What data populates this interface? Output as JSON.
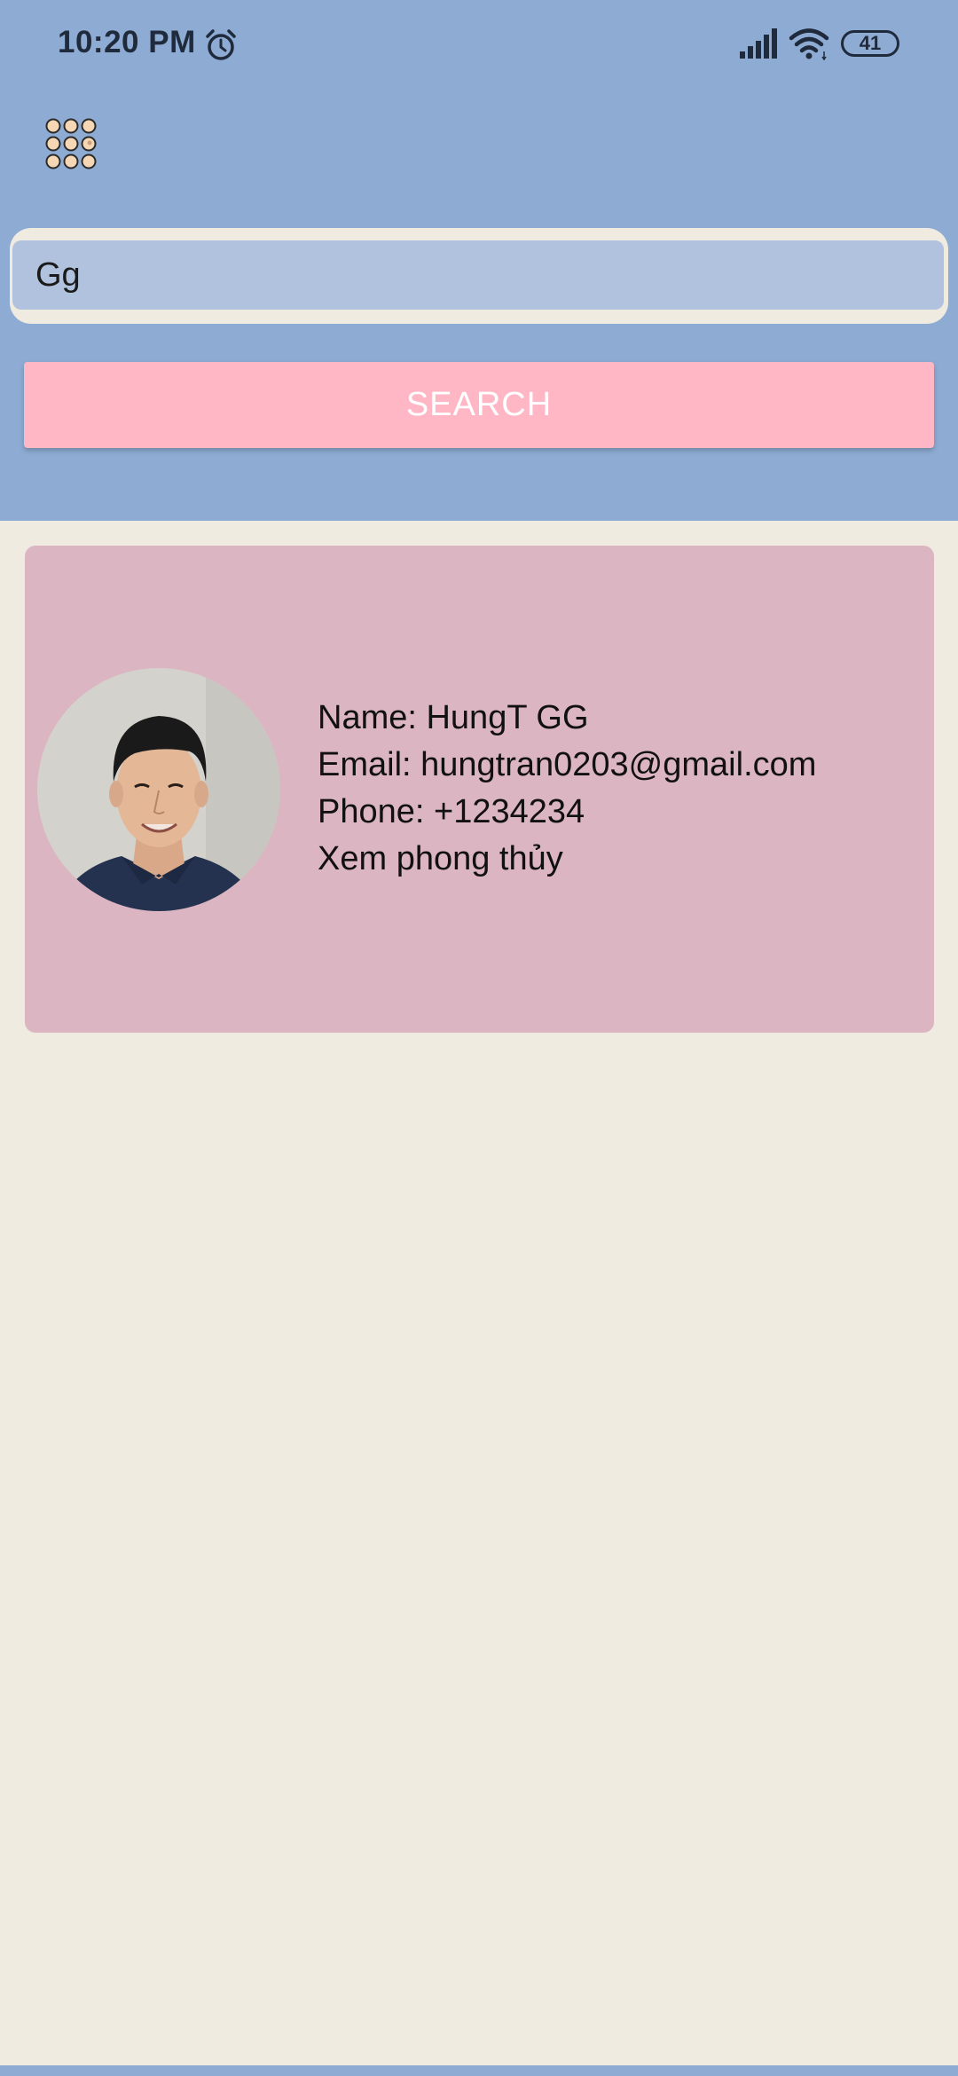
{
  "status_bar": {
    "time": "10:20 PM",
    "alarm_icon": "alarm-clock-icon",
    "signal_icon": "cell-signal-icon",
    "wifi_icon": "wifi-icon",
    "battery_level": "41"
  },
  "toolbar": {
    "menu_icon": "grid-menu-icon"
  },
  "search": {
    "value": "Gg",
    "button_label": "SEARCH"
  },
  "results": [
    {
      "name_line": "Name: HungT GG",
      "email_line": "Email: hungtran0203@gmail.com",
      "phone_line": "Phone: +1234234",
      "link_line": "Xem phong thủy"
    }
  ],
  "colors": {
    "header_bg": "#8EACD3",
    "page_bg": "#EFEBE1",
    "input_bg": "#B0C2DD",
    "button_bg": "#FFB6C5",
    "card_bg": "#DCB5C2"
  }
}
